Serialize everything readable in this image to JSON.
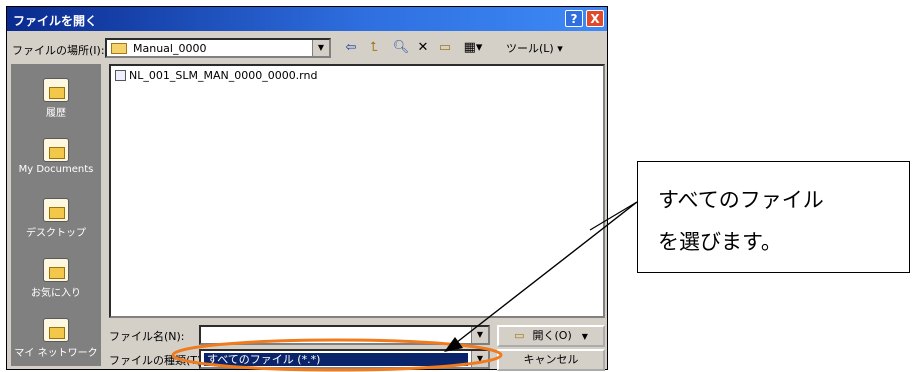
{
  "dialog": {
    "title": "ファイルを開く",
    "help_label": "?",
    "close_label": "X"
  },
  "lookin": {
    "label": "ファイルの場所(I):",
    "value": "Manual_0000",
    "tools_label": "ツール(L) ▾"
  },
  "places": [
    {
      "label": "履歴",
      "icon": "history-icon"
    },
    {
      "label": "My Documents",
      "icon": "my-documents-icon"
    },
    {
      "label": "デスクトップ",
      "icon": "desktop-icon"
    },
    {
      "label": "お気に入り",
      "icon": "favorites-icon"
    },
    {
      "label": "マイ ネットワーク",
      "icon": "network-icon"
    }
  ],
  "files": [
    {
      "name": "NL_001_SLM_MAN_0000_0000.rnd"
    }
  ],
  "filename": {
    "label": "ファイル名(N):",
    "value": ""
  },
  "filetype": {
    "label": "ファイルの種類(T):",
    "value": "すべてのファイル (*.*)"
  },
  "buttons": {
    "open_label": "開く(O)",
    "cancel_label": "キャンセル"
  },
  "annotation": {
    "line1": "すべてのファイル",
    "line2": "を選びます。",
    "highlight_color": "#f07a1e"
  }
}
